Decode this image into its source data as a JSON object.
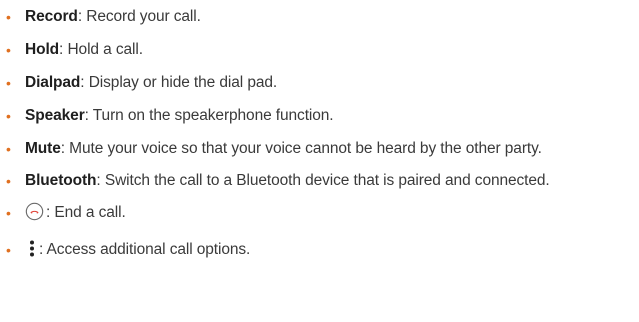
{
  "items": [
    {
      "term": "Record",
      "desc": ": Record your call."
    },
    {
      "term": "Hold",
      "desc": ": Hold a call."
    },
    {
      "term": "Dialpad",
      "desc": ": Display or hide the dial pad."
    },
    {
      "term": "Speaker",
      "desc": ": Turn on the speakerphone function."
    },
    {
      "term": "Mute",
      "desc": ": Mute your voice so that your voice cannot be heard by the other party."
    },
    {
      "term": "Bluetooth",
      "desc": ": Switch the call to a Bluetooth device that is paired and connected."
    },
    {
      "icon": "end-call-icon",
      "desc": ": End a call."
    },
    {
      "icon": "more-options-icon",
      "desc": ": Access additional call options."
    }
  ],
  "colors": {
    "bullet": "#e07020",
    "end_call": "#e0453a",
    "text": "#3a3a3a"
  }
}
